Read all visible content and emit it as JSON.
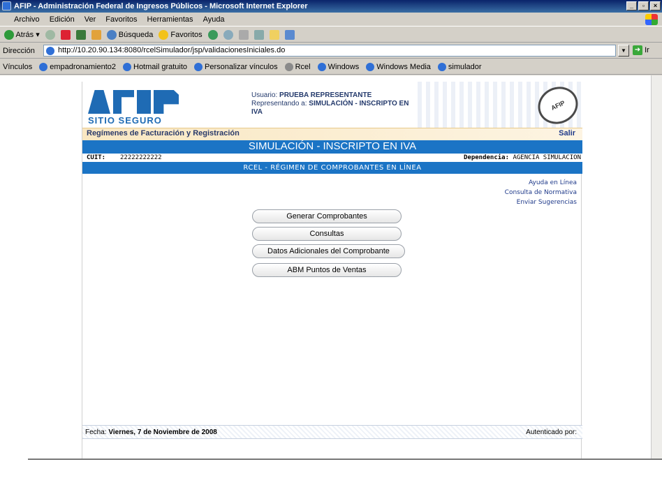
{
  "window": {
    "title": "AFIP - Administración Federal de Ingresos Públicos - Microsoft Internet Explorer",
    "controls": [
      "_",
      "▫",
      "×"
    ]
  },
  "menu": [
    "Archivo",
    "Edición",
    "Ver",
    "Favoritos",
    "Herramientas",
    "Ayuda"
  ],
  "toolbar": {
    "back": "Atrás",
    "search": "Búsqueda",
    "favorites": "Favoritos"
  },
  "address": {
    "label": "Dirección",
    "url": "http://10.20.90.134:8080/rcelSimulador/jsp/validacionesIniciales.do",
    "go": "Ir"
  },
  "links": {
    "label": "Vínculos",
    "items": [
      "empadronamiento2",
      "Hotmail gratuito",
      "Personalizar vínculos",
      "Rcel",
      "Windows",
      "Windows Media",
      "simulador"
    ]
  },
  "header": {
    "logo_text": "SITIO SEGURO",
    "user_label": "Usuario:",
    "user_value": "PRUEBA REPRESENTANTE",
    "rep_label": "Representando a:",
    "rep_value": "SIMULACIÓN - INSCRIPTO EN IVA"
  },
  "regimen_bar": {
    "title": "Regímenes de Facturación y Registración",
    "exit": "Salir"
  },
  "sim_title": "SIMULACIÓN - INSCRIPTO EN IVA",
  "cuit": {
    "label": "CUIT:",
    "value": "22222222222",
    "dep_label": "Dependencia:",
    "dep_value": "AGENCIA SIMULACION"
  },
  "rcel_title": "RCEL - RÉGIMEN DE COMPROBANTES EN LÍNEA",
  "help_links": [
    "Ayuda en Línea",
    "Consulta de Normativa",
    "Enviar Sugerencias"
  ],
  "buttons": [
    "Generar Comprobantes",
    "Consultas",
    "Datos Adicionales del Comprobante",
    "ABM Puntos de Ventas"
  ],
  "footer": {
    "fecha_label": "Fecha:",
    "fecha_value": "Viernes, 7 de Noviembre de 2008",
    "auth": "Autenticado por:"
  }
}
